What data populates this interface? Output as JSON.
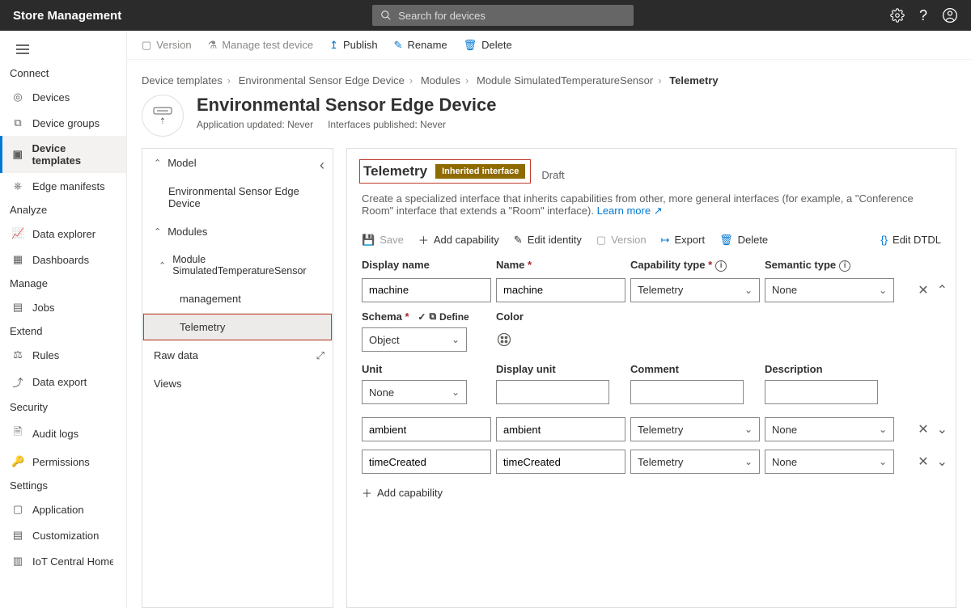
{
  "app_title": "Store Management",
  "search_placeholder": "Search for devices",
  "commandbar": {
    "version": "Version",
    "manage_test": "Manage test device",
    "publish": "Publish",
    "rename": "Rename",
    "delete": "Delete"
  },
  "sidebar": {
    "sections": {
      "connect": "Connect",
      "analyze": "Analyze",
      "manage": "Manage",
      "extend": "Extend",
      "security": "Security",
      "settings": "Settings"
    },
    "items": {
      "devices": "Devices",
      "device_groups": "Device groups",
      "device_templates": "Device templates",
      "edge_manifests": "Edge manifests",
      "data_explorer": "Data explorer",
      "dashboards": "Dashboards",
      "jobs": "Jobs",
      "rules": "Rules",
      "data_export": "Data export",
      "audit_logs": "Audit logs",
      "permissions": "Permissions",
      "application": "Application",
      "customization": "Customization",
      "iot_central_home": "IoT Central Home"
    }
  },
  "breadcrumbs": {
    "a": "Device templates",
    "b": "Environmental Sensor Edge Device",
    "c": "Modules",
    "d": "Module SimulatedTemperatureSensor",
    "e": "Telemetry"
  },
  "page_title": "Environmental Sensor Edge Device",
  "meta": {
    "app_updated": "Application updated: Never",
    "interfaces_pub": "Interfaces published: Never"
  },
  "tree": {
    "model": "Model",
    "root": "Environmental Sensor Edge Device",
    "modules": "Modules",
    "module_sim": "Module SimulatedTemperatureSensor",
    "management": "management",
    "telemetry": "Telemetry",
    "raw_data": "Raw data",
    "views": "Views"
  },
  "panel": {
    "title": "Telemetry",
    "badge": "Inherited interface",
    "status": "Draft",
    "desc1": "Create a specialized interface that inherits capabilities from other, more general interfaces (for example, a \"Conference Room\" interface that extends a \"Room\" interface). ",
    "learn_more": "Learn more"
  },
  "toolbar": {
    "save": "Save",
    "add_cap": "Add capability",
    "edit_identity": "Edit identity",
    "version": "Version",
    "export": "Export",
    "delete": "Delete",
    "edit_dtdl": "Edit DTDL"
  },
  "columns": {
    "display_name": "Display name",
    "name": "Name",
    "cap_type": "Capability type",
    "semantic_type": "Semantic type"
  },
  "rows": [
    {
      "display": "machine",
      "name": "machine",
      "cap": "Telemetry",
      "sem": "None"
    },
    {
      "display": "ambient",
      "name": "ambient",
      "cap": "Telemetry",
      "sem": "None"
    },
    {
      "display": "timeCreated",
      "name": "timeCreated",
      "cap": "Telemetry",
      "sem": "None"
    }
  ],
  "expanded": {
    "schema_lbl": "Schema",
    "define": "Define",
    "color_lbl": "Color",
    "schema_val": "Object",
    "unit_lbl": "Unit",
    "display_unit_lbl": "Display unit",
    "comment_lbl": "Comment",
    "description_lbl": "Description",
    "unit_val": "None"
  },
  "add_capability_btn": "Add capability"
}
